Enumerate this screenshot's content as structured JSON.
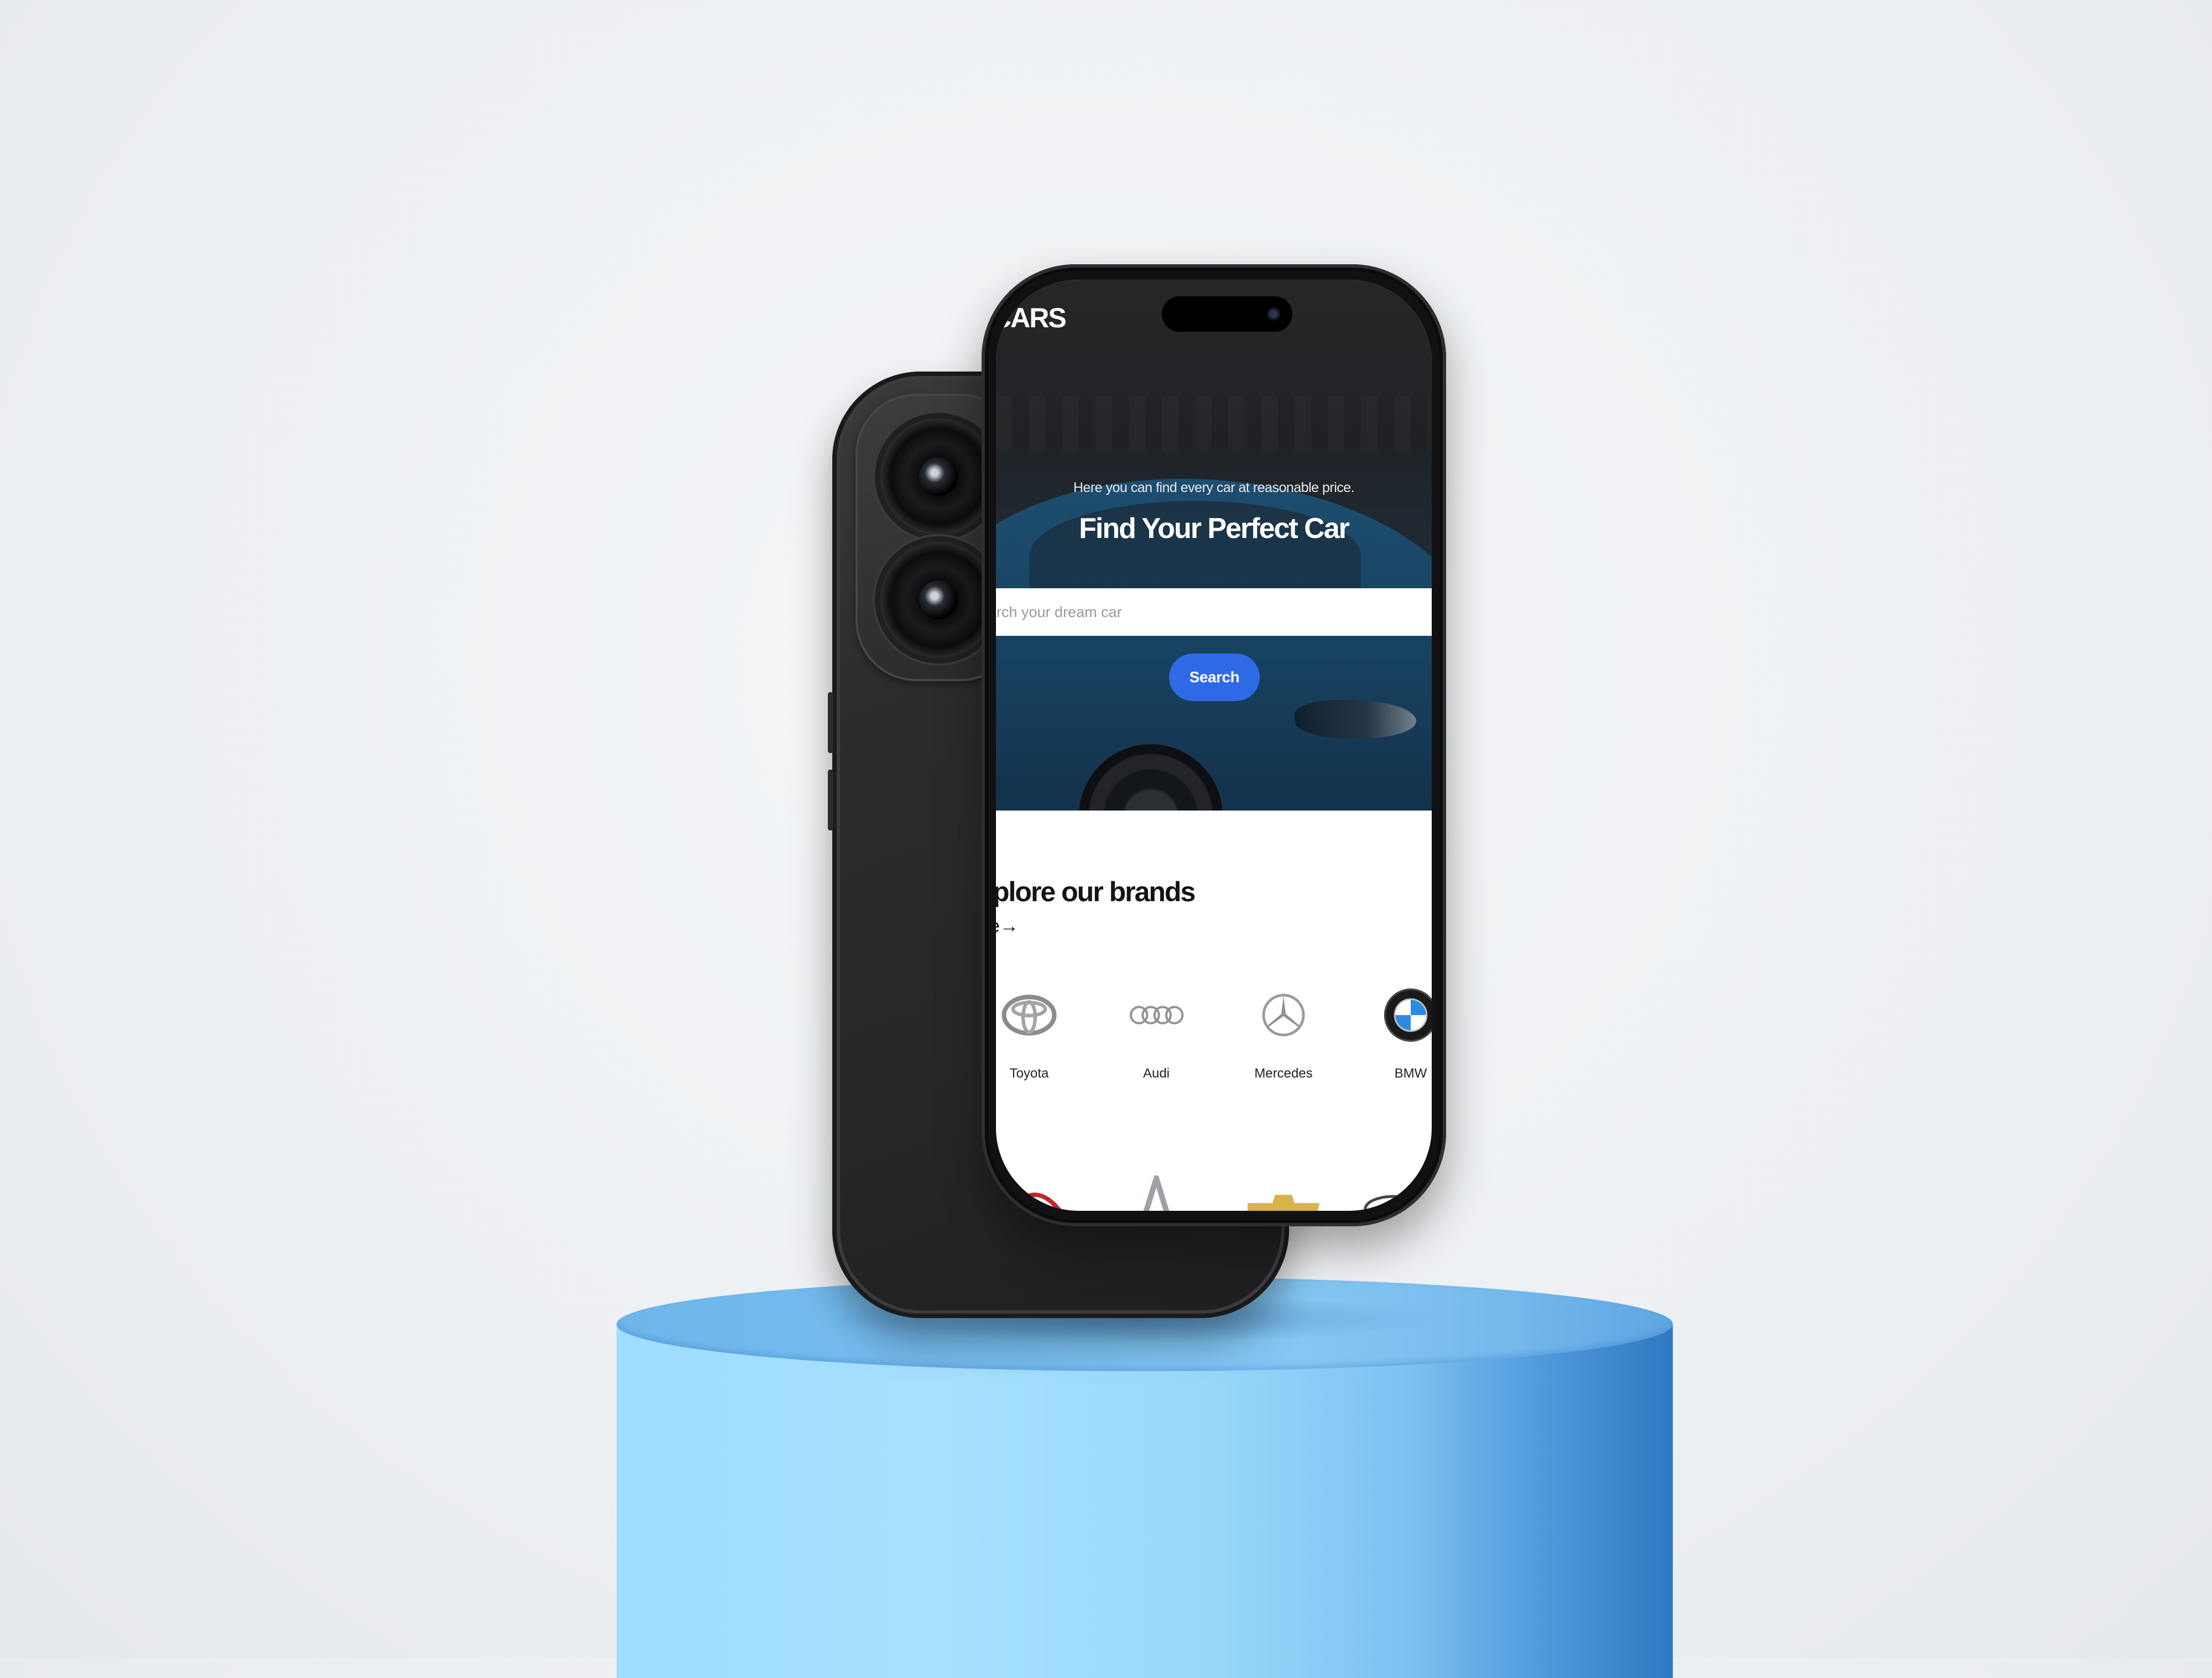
{
  "app": {
    "logo": "CARS"
  },
  "hero": {
    "tagline": "Here you can find every car at reasonable price.",
    "title": "Find Your Perfect Car",
    "search_placeholder": "arch your dream car",
    "search_button": "Search"
  },
  "brands": {
    "title": "plore our brands",
    "see_more": "e→",
    "items": [
      {
        "label": "Toyota",
        "icon": "toyota-logo"
      },
      {
        "label": "Audi",
        "icon": "audi-logo"
      },
      {
        "label": "Mercedes",
        "icon": "mercedes-logo"
      },
      {
        "label": "BMW",
        "icon": "bmw-logo"
      }
    ],
    "next_row_icons": [
      "red-brand-logo",
      "silver-brand-logo",
      "chevrolet-logo",
      "oval-brand-logo"
    ]
  },
  "colors": {
    "accent": "#2f6ae6",
    "pedestal": "#8fd0f8",
    "phone_body": "#2a2a2c"
  }
}
